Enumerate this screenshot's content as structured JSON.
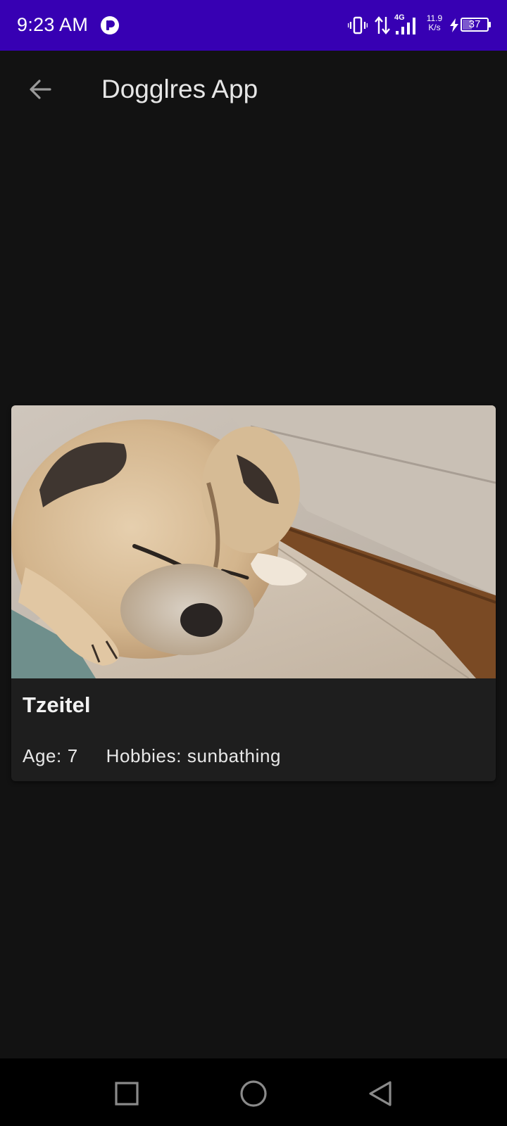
{
  "status_bar": {
    "time": "9:23 AM",
    "network_type": "4G",
    "net_speed_value": "11.9",
    "net_speed_unit": "K/s",
    "battery_level": "37",
    "background_color": "#3700b3"
  },
  "app_bar": {
    "title": "Dogglres App",
    "back_icon": "arrow-left-icon"
  },
  "card": {
    "name": "Tzeitel",
    "age_label": "Age: 7",
    "hobbies_label": "Hobbies: sunbathing",
    "photo": "sleeping-pug-photo"
  },
  "nav_bar": {
    "recents_icon": "square-icon",
    "home_icon": "circle-icon",
    "back_icon": "triangle-back-icon"
  },
  "colors": {
    "background": "#121212",
    "card": "#1e1e1e",
    "text": "#e8e8e8"
  }
}
